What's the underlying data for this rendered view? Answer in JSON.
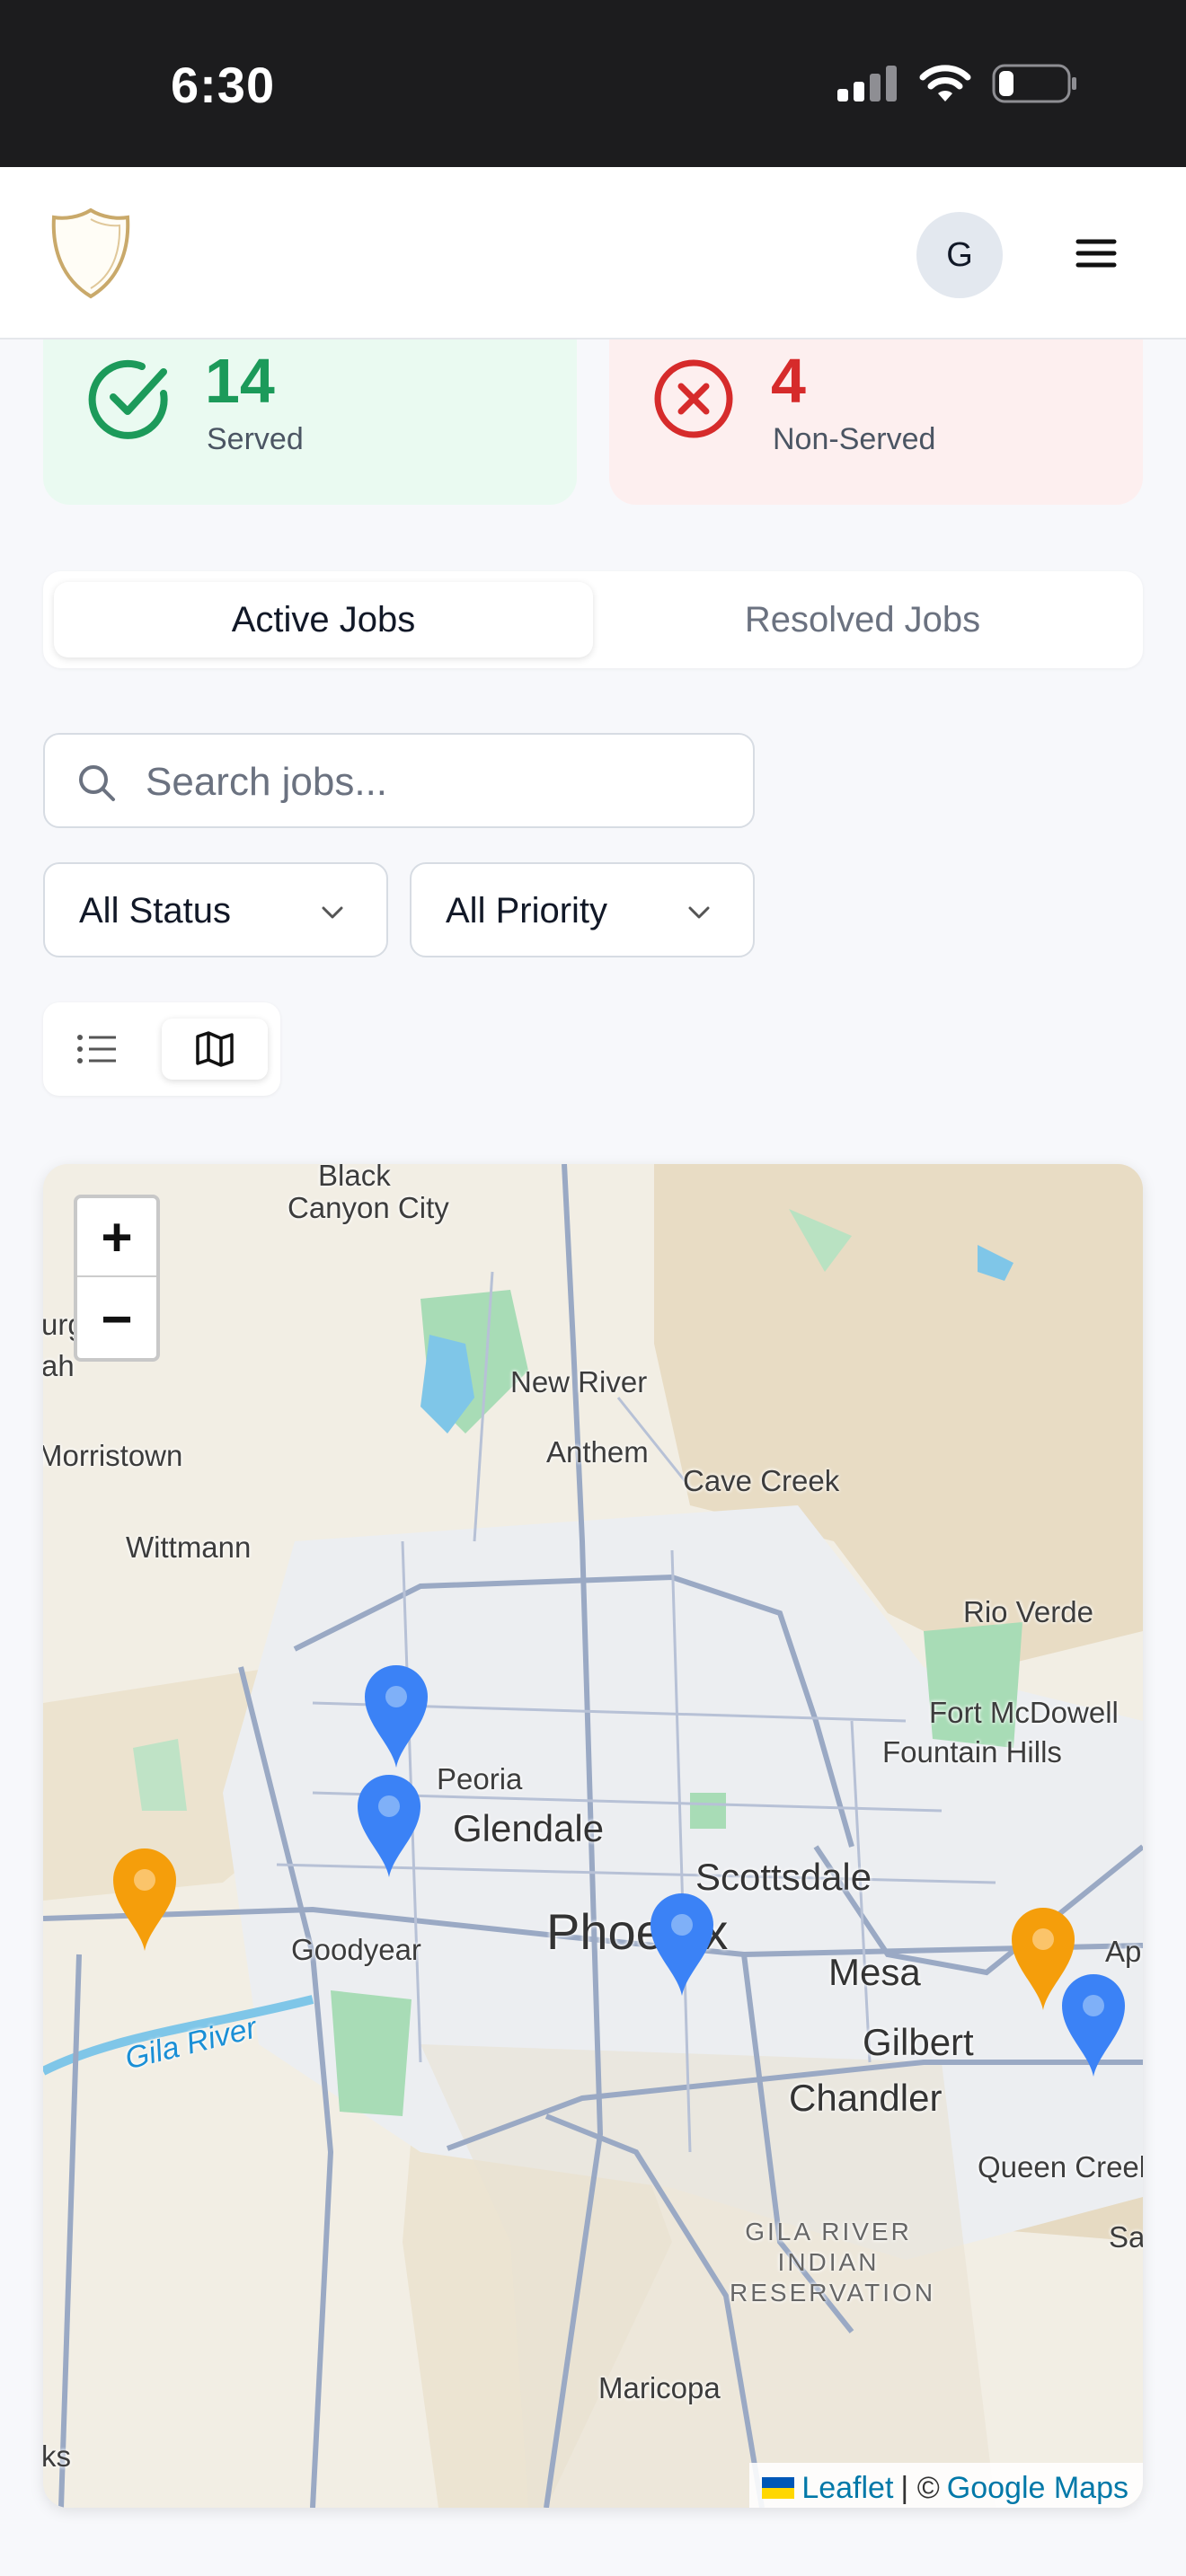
{
  "status_bar": {
    "time": "6:30"
  },
  "header": {
    "avatar_initial": "G"
  },
  "stats": {
    "served": {
      "count": "14",
      "label": "Served",
      "color": "#1c9a5a"
    },
    "non_served": {
      "count": "4",
      "label": "Non-Served",
      "color": "#d62b2b"
    }
  },
  "tabs": [
    {
      "label": "Active Jobs",
      "active": true
    },
    {
      "label": "Resolved Jobs",
      "active": false
    }
  ],
  "search": {
    "placeholder": "Search jobs..."
  },
  "filters": {
    "status": "All Status",
    "priority": "All Priority"
  },
  "view_toggle": {
    "selected": "map",
    "options": [
      "list-icon",
      "map-icon"
    ]
  },
  "map": {
    "zoom_in": "+",
    "zoom_out": "−",
    "labels": {
      "black_canyon_1": "Black",
      "black_canyon_2": "Canyon City",
      "new_river": "New River",
      "anthem": "Anthem",
      "cave_creek": "Cave Creek",
      "morristown": "Morristown",
      "wittmann": "Wittmann",
      "rio_verde": "Rio Verde",
      "fort_mcdowell": "Fort McDowell",
      "fountain_hills": "Fountain Hills",
      "peoria": "Peoria",
      "glendale": "Glendale",
      "scottsdale": "Scottsdale",
      "phoenix": "Phoenix",
      "mesa": "Mesa",
      "goodyear": "Goodyear",
      "gilbert": "Gilbert",
      "chandler": "Chandler",
      "gila_river": "Gila River",
      "queen_creek": "Queen Creek",
      "reservation_1": "GILA RIVER",
      "reservation_2": "INDIAN",
      "reservation_3": "RESERVATION",
      "maricopa": "Maricopa",
      "apache": "Ap",
      "san_tan": "Sa",
      "edge_urg": "urg",
      "edge_ah": "ah",
      "edge_ks": "ks"
    },
    "markers": [
      {
        "color": "blue"
      },
      {
        "color": "blue"
      },
      {
        "color": "orange"
      },
      {
        "color": "blue"
      },
      {
        "color": "orange"
      },
      {
        "color": "blue"
      }
    ],
    "marker_colors": {
      "blue": "#3b82f6",
      "orange": "#f59e0b"
    },
    "attribution": {
      "leaflet": "Leaflet",
      "separator": "| ©",
      "provider": "Google Maps"
    }
  }
}
